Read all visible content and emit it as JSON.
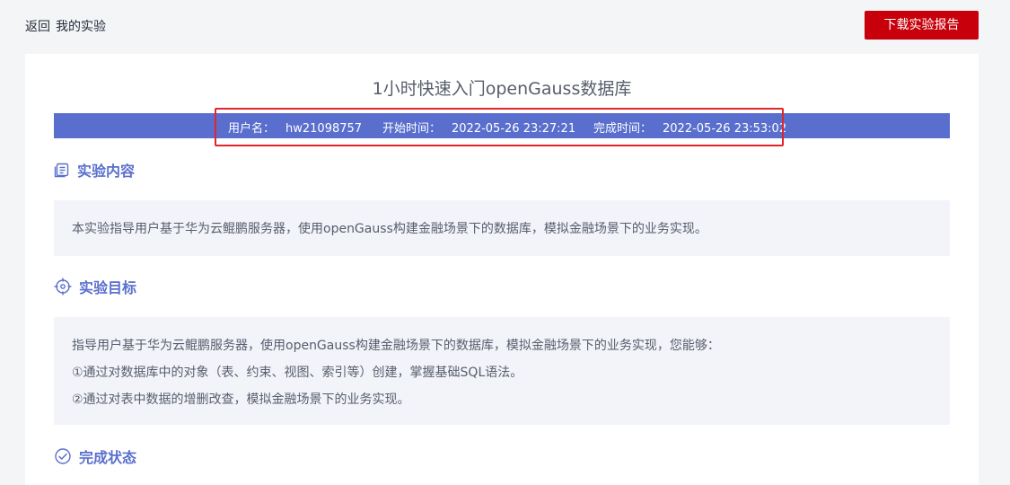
{
  "header": {
    "back_label": "返回",
    "page_title": "我的实验",
    "download_label": "下载实验报告"
  },
  "lab": {
    "title": "1小时快速入门openGauss数据库",
    "username_label": "用户名：",
    "username": "hw21098757",
    "start_label": "开始时间：",
    "start_time": "2022-05-26 23:27:21",
    "end_label": "完成时间：",
    "end_time": "2022-05-26 23:53:02"
  },
  "sections": {
    "content": {
      "title": "实验内容",
      "icon": "document-icon",
      "text": "本实验指导用户基于华为云鲲鹏服务器，使用openGauss构建金融场景下的数据库，模拟金融场景下的业务实现。"
    },
    "goal": {
      "title": "实验目标",
      "icon": "target-icon",
      "lines": [
        "指导用户基于华为云鲲鹏服务器，使用openGauss构建金融场景下的数据库，模拟金融场景下的业务实现，您能够：",
        "①通过对数据库中的对象（表、约束、视图、索引等）创建，掌握基础SQL语法。",
        "②通过对表中数据的增删改查，模拟金融场景下的业务实现。"
      ]
    },
    "status": {
      "title": "完成状态",
      "icon": "check-circle-icon"
    }
  },
  "colors": {
    "accent": "#5a6fcd",
    "brand_red": "#c7000b",
    "highlight": "#e0262c"
  }
}
